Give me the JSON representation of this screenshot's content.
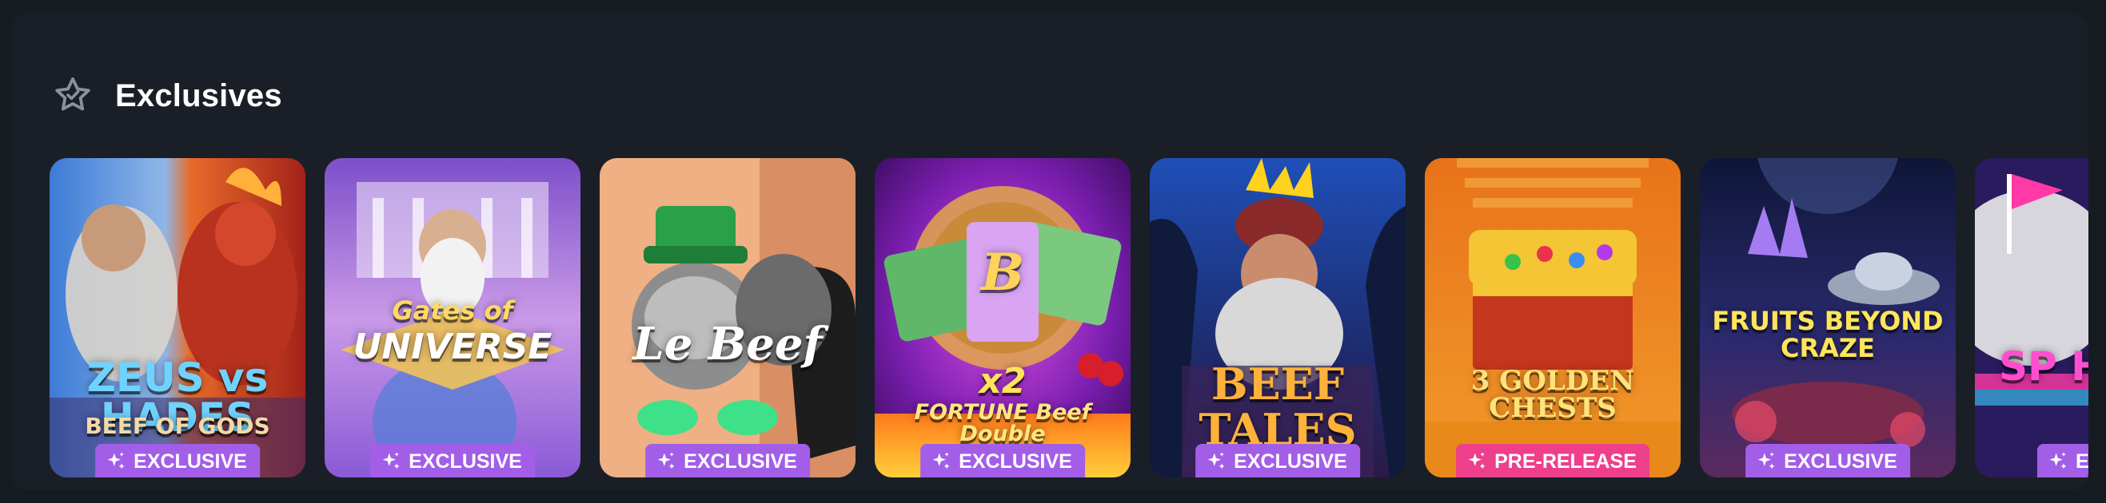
{
  "section": {
    "title": "Exclusives",
    "icon": "star-outline-icon"
  },
  "colors": {
    "page_bg": "#161b22",
    "panel_bg": "#1a1f27",
    "exclusive_badge": "#a35ee8",
    "prerelease_badge": "#ee3f8b"
  },
  "games": [
    {
      "name": "ZEUS vs HADES",
      "subtitle": "BEEF OF GODS",
      "badge": "EXCLUSIVE"
    },
    {
      "name": "Gates of",
      "subtitle": "UNIVERSE",
      "badge": "EXCLUSIVE"
    },
    {
      "name": "Le Beef",
      "badge": "EXCLUSIVE"
    },
    {
      "name": "x2",
      "subtitle": "FORTUNE Beef Double",
      "badge": "EXCLUSIVE"
    },
    {
      "name": "BEEF TALES",
      "badge": "EXCLUSIVE"
    },
    {
      "name": "3 GOLDEN CHESTS",
      "badge": "PRE-RELEASE"
    },
    {
      "name": "FRUITS BEYOND CRAZE",
      "badge": "EXCLUSIVE"
    },
    {
      "name": "SP HE",
      "badge": "EX"
    }
  ]
}
